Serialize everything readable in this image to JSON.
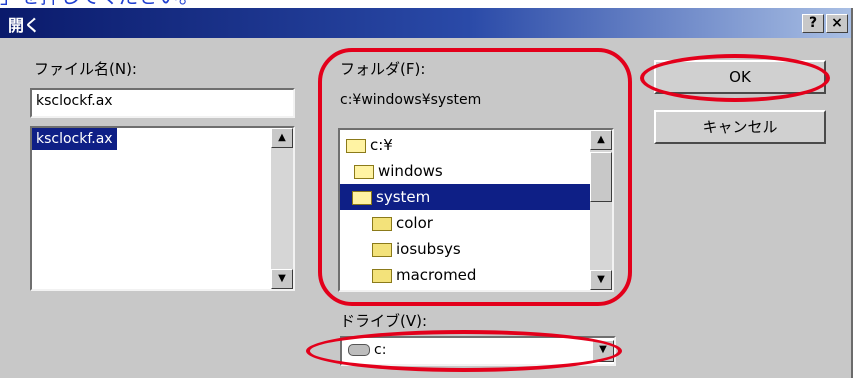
{
  "top_caption": "」を押してください。",
  "dialog": {
    "title": "開く",
    "help_button": "?",
    "close_button": "×"
  },
  "file_name": {
    "label": "ファイル名(N):",
    "value": "ksclockf.ax",
    "list": [
      "ksclockf.ax"
    ]
  },
  "folder": {
    "label": "フォルダ(F):",
    "path": "c:¥windows¥system",
    "tree": [
      {
        "label": "c:¥",
        "indent": 0,
        "open": true,
        "selected": false
      },
      {
        "label": "windows",
        "indent": 1,
        "open": true,
        "selected": false
      },
      {
        "label": "system",
        "indent": 2,
        "open": true,
        "selected": true
      },
      {
        "label": "color",
        "indent": 3,
        "open": false,
        "selected": false
      },
      {
        "label": "iosubsys",
        "indent": 3,
        "open": false,
        "selected": false
      },
      {
        "label": "macromed",
        "indent": 3,
        "open": false,
        "selected": false
      }
    ]
  },
  "buttons": {
    "ok": "OK",
    "cancel": "キャンセル"
  },
  "drive": {
    "label": "ドライブ(V):",
    "value": "c:"
  },
  "scroll_arrows": {
    "up": "▲",
    "down": "▼"
  },
  "colors": {
    "highlight_ring": "#e3001b",
    "selection": "#0e1f86",
    "caption": "#1f3fd0"
  }
}
